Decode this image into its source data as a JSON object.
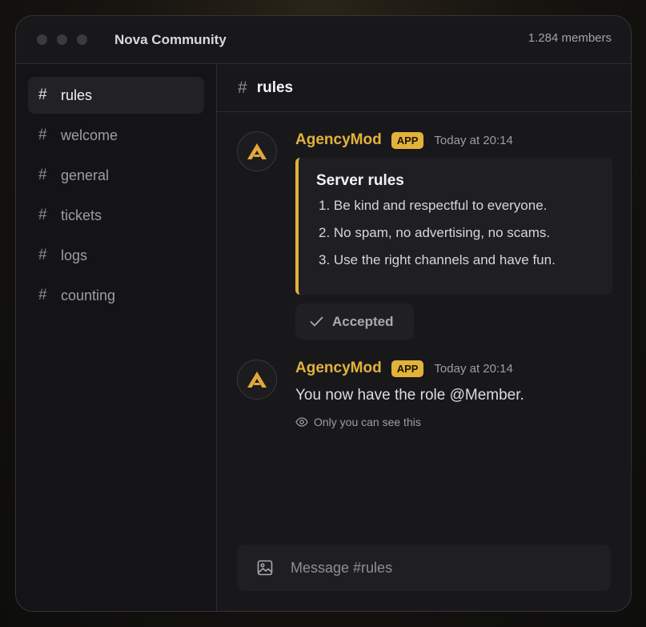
{
  "window": {
    "title": "Nova Community",
    "member_count": "1.284 members"
  },
  "sidebar": {
    "channels": [
      {
        "label": "rules",
        "active": true
      },
      {
        "label": "welcome",
        "active": false
      },
      {
        "label": "general",
        "active": false
      },
      {
        "label": "tickets",
        "active": false
      },
      {
        "label": "logs",
        "active": false
      },
      {
        "label": "counting",
        "active": false
      }
    ]
  },
  "header": {
    "hash": "#",
    "channel_name": "rules"
  },
  "messages": [
    {
      "author": "AgencyMod",
      "badge": "APP",
      "timestamp": "Today at 20:14",
      "embed": {
        "title": "Server rules",
        "items": [
          "1. Be kind and respectful to everyone.",
          "2. No spam, no advertising, no scams.",
          "3. Use the right channels and have fun."
        ]
      },
      "button": {
        "label": "Accepted",
        "icon": "check-icon"
      }
    },
    {
      "author": "AgencyMod",
      "badge": "APP",
      "timestamp": "Today at 20:14",
      "text": "You now have the role @Member.",
      "ephemeral_note": "Only you can see this",
      "ephemeral_icon": "eye-icon"
    }
  ],
  "composer": {
    "placeholder": "Message #rules",
    "icon": "image-icon"
  },
  "colors": {
    "accent": "#e2b23b",
    "background": "#18181b",
    "sidebar": "#141416"
  }
}
